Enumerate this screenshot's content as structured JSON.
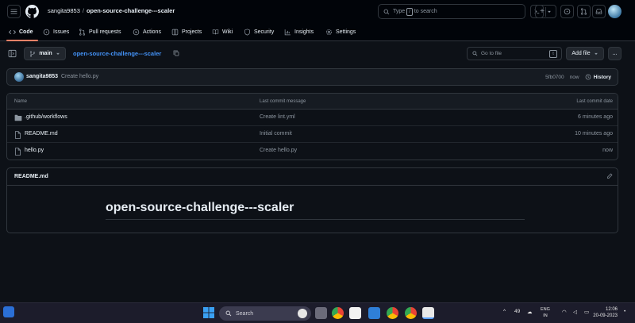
{
  "header": {
    "owner": "sangita9853",
    "separator": "/",
    "repo": "open-source-challenge---scaler",
    "search": {
      "prefix": "Type",
      "key": "/",
      "suffix": "to search"
    }
  },
  "tabs": [
    {
      "label": "Code",
      "icon": "code-icon"
    },
    {
      "label": "Issues",
      "icon": "issue-opened-icon"
    },
    {
      "label": "Pull requests",
      "icon": "git-pull-request-icon"
    },
    {
      "label": "Actions",
      "icon": "play-icon"
    },
    {
      "label": "Projects",
      "icon": "table-icon"
    },
    {
      "label": "Wiki",
      "icon": "book-icon"
    },
    {
      "label": "Security",
      "icon": "shield-icon"
    },
    {
      "label": "Insights",
      "icon": "graph-icon"
    },
    {
      "label": "Settings",
      "icon": "gear-icon"
    }
  ],
  "repo_bar": {
    "branch": "main",
    "path": "open-source-challenge---scaler",
    "goto_placeholder": "Go to file",
    "goto_key": "t",
    "add_file": "Add file",
    "more": "..."
  },
  "commit": {
    "author": "sangita9853",
    "message": "Create hello.py",
    "sha": "5fb0700",
    "time": "now",
    "history": "History"
  },
  "files": {
    "headers": {
      "name": "Name",
      "message": "Last commit message",
      "date": "Last commit date"
    },
    "rows": [
      {
        "name": ".github/workflows",
        "type": "folder",
        "message": "Create lint.yml",
        "date": "6 minutes ago"
      },
      {
        "name": "README.md",
        "type": "file",
        "message": "Initial commit",
        "date": "10 minutes ago"
      },
      {
        "name": "hello.py",
        "type": "file",
        "message": "Create hello.py",
        "date": "now"
      }
    ]
  },
  "readme": {
    "title": "README.md",
    "heading": "open-source-challenge---scaler"
  },
  "taskbar": {
    "search": "Search",
    "temp": "49",
    "lang_top": "ENG",
    "lang_bottom": "IN",
    "time": "12:06",
    "date": "20-09-2023"
  },
  "colors": {
    "accent_link": "#4493f8",
    "tab_underline": "#f78166",
    "background": "#0d1117"
  }
}
